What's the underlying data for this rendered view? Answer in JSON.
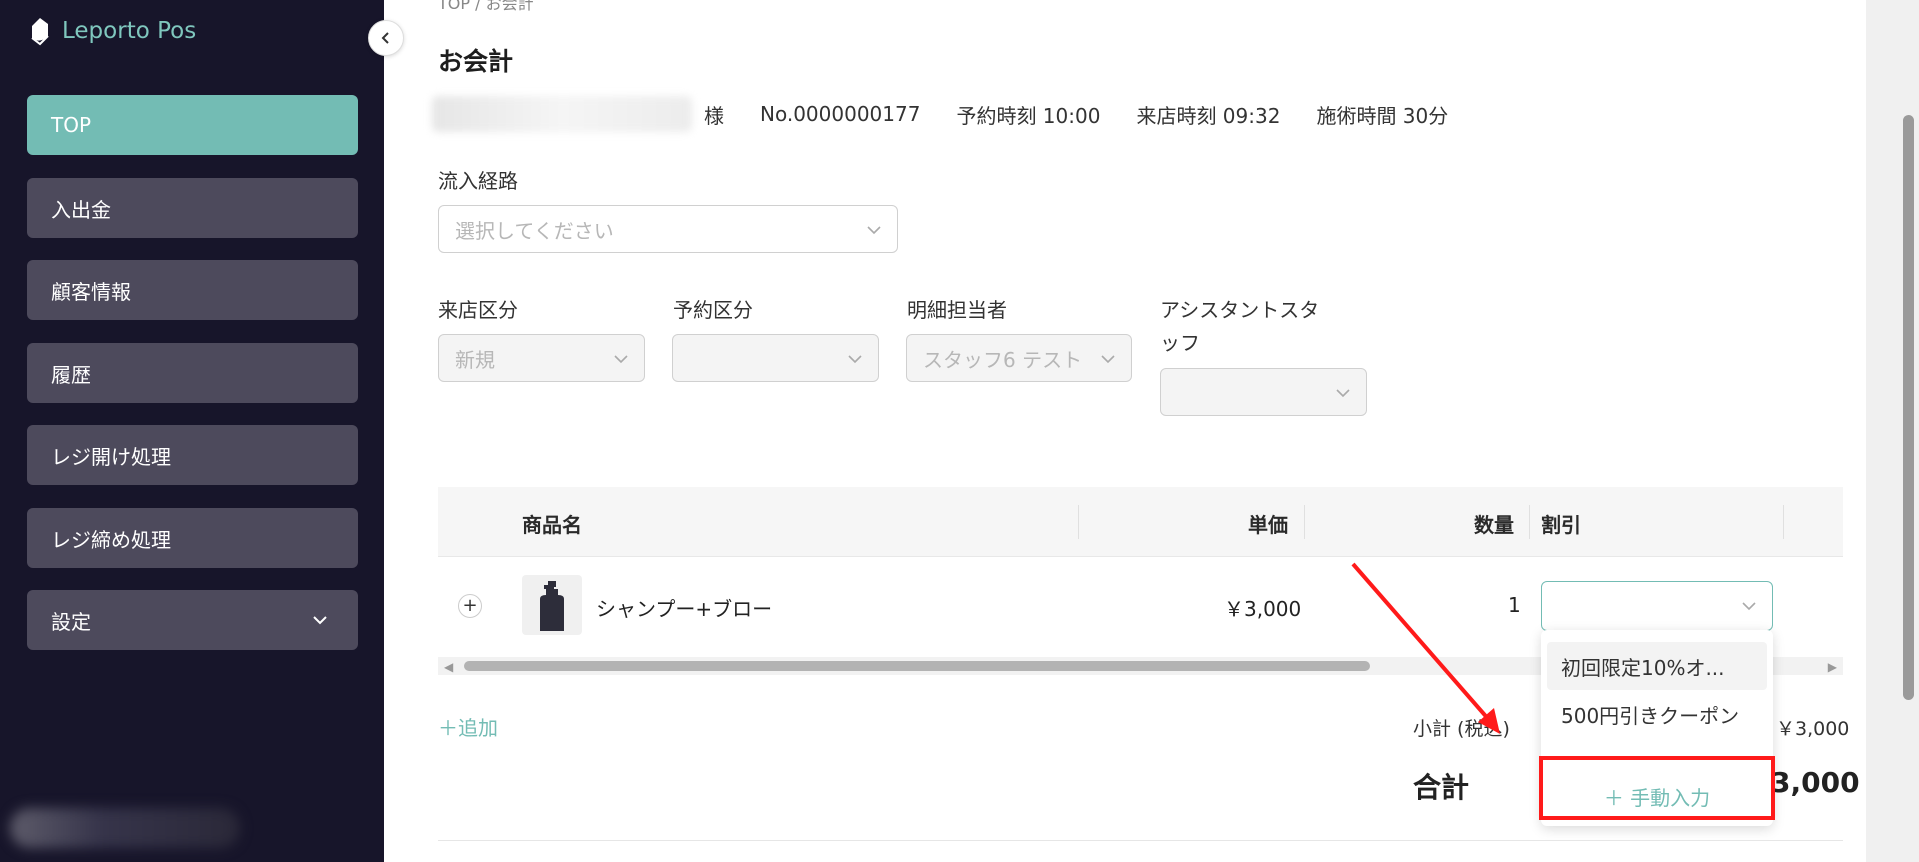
{
  "app": {
    "name": "Leporto Pos"
  },
  "sidebar": {
    "items": [
      {
        "label": "TOP",
        "active": true
      },
      {
        "label": "入出金"
      },
      {
        "label": "顧客情報"
      },
      {
        "label": "履歴"
      },
      {
        "label": "レジ開け処理"
      },
      {
        "label": "レジ締め処理"
      },
      {
        "label": "設定",
        "has_submenu": true
      }
    ]
  },
  "breadcrumb": "TOP / お会計",
  "page": {
    "title": "お会計"
  },
  "reservation": {
    "honorific": "様",
    "number": "No.0000000177",
    "reserved_time": "予約時刻 10:00",
    "arrival_time": "来店時刻 09:32",
    "duration": "施術時間 30分"
  },
  "form": {
    "source_label": "流入経路",
    "source_placeholder": "選択してください",
    "visit_type_label": "来店区分",
    "visit_type_value": "新規",
    "reservation_type_label": "予約区分",
    "staff_label": "明細担当者",
    "staff_value": "スタッフ6 テスト",
    "assistant_label_1": "アシスタントスタ",
    "assistant_label_2": "ッフ"
  },
  "table": {
    "headers": {
      "product": "商品名",
      "unit_price": "単価",
      "quantity": "数量",
      "discount": "割引"
    },
    "rows": [
      {
        "expand": "+",
        "product": "シャンプー+ブロー",
        "unit_price": "￥3,000",
        "quantity": "1"
      }
    ]
  },
  "discount_dropdown": {
    "options": [
      "初回限定10%オ...",
      "500円引きクーポン"
    ],
    "manual_entry": "＋ 手動入力"
  },
  "summary": {
    "add_label": "＋追加",
    "subtotal_label": "小計 (税込)",
    "subtotal_value": "￥3,000",
    "total_label": "合計",
    "total_value": "3,000"
  },
  "colors": {
    "sidebar_bg": "#17152a",
    "accent": "#73bcb4",
    "nav_item": "#4d4a5c",
    "annotation": "#ff1a1a"
  }
}
